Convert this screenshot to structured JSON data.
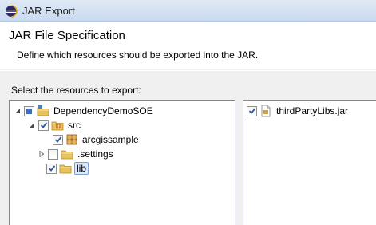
{
  "window": {
    "title": "JAR Export"
  },
  "banner": {
    "heading": "JAR File Specification",
    "description": "Define which resources should be exported into the JAR."
  },
  "resources": {
    "label": "Select the resources to export:",
    "tree": [
      {
        "label": "DependencyDemoSOE",
        "state": "mixed",
        "expanded": true,
        "icon": "project-icon"
      },
      {
        "label": "src",
        "state": "checked",
        "expanded": true,
        "icon": "source-folder-icon"
      },
      {
        "label": "arcgissample",
        "state": "checked",
        "icon": "package-icon"
      },
      {
        "label": ".settings",
        "state": "unchecked",
        "expanded": false,
        "icon": "folder-icon"
      },
      {
        "label": "lib",
        "state": "checked",
        "icon": "folder-icon"
      }
    ],
    "files": [
      {
        "label": "thirdPartyLibs.jar",
        "state": "checked",
        "icon": "jar-file-icon"
      }
    ]
  },
  "colors": {
    "checkmark": "#2d5a9e",
    "folder": "#e8c25a",
    "selection": "#dceafc"
  }
}
